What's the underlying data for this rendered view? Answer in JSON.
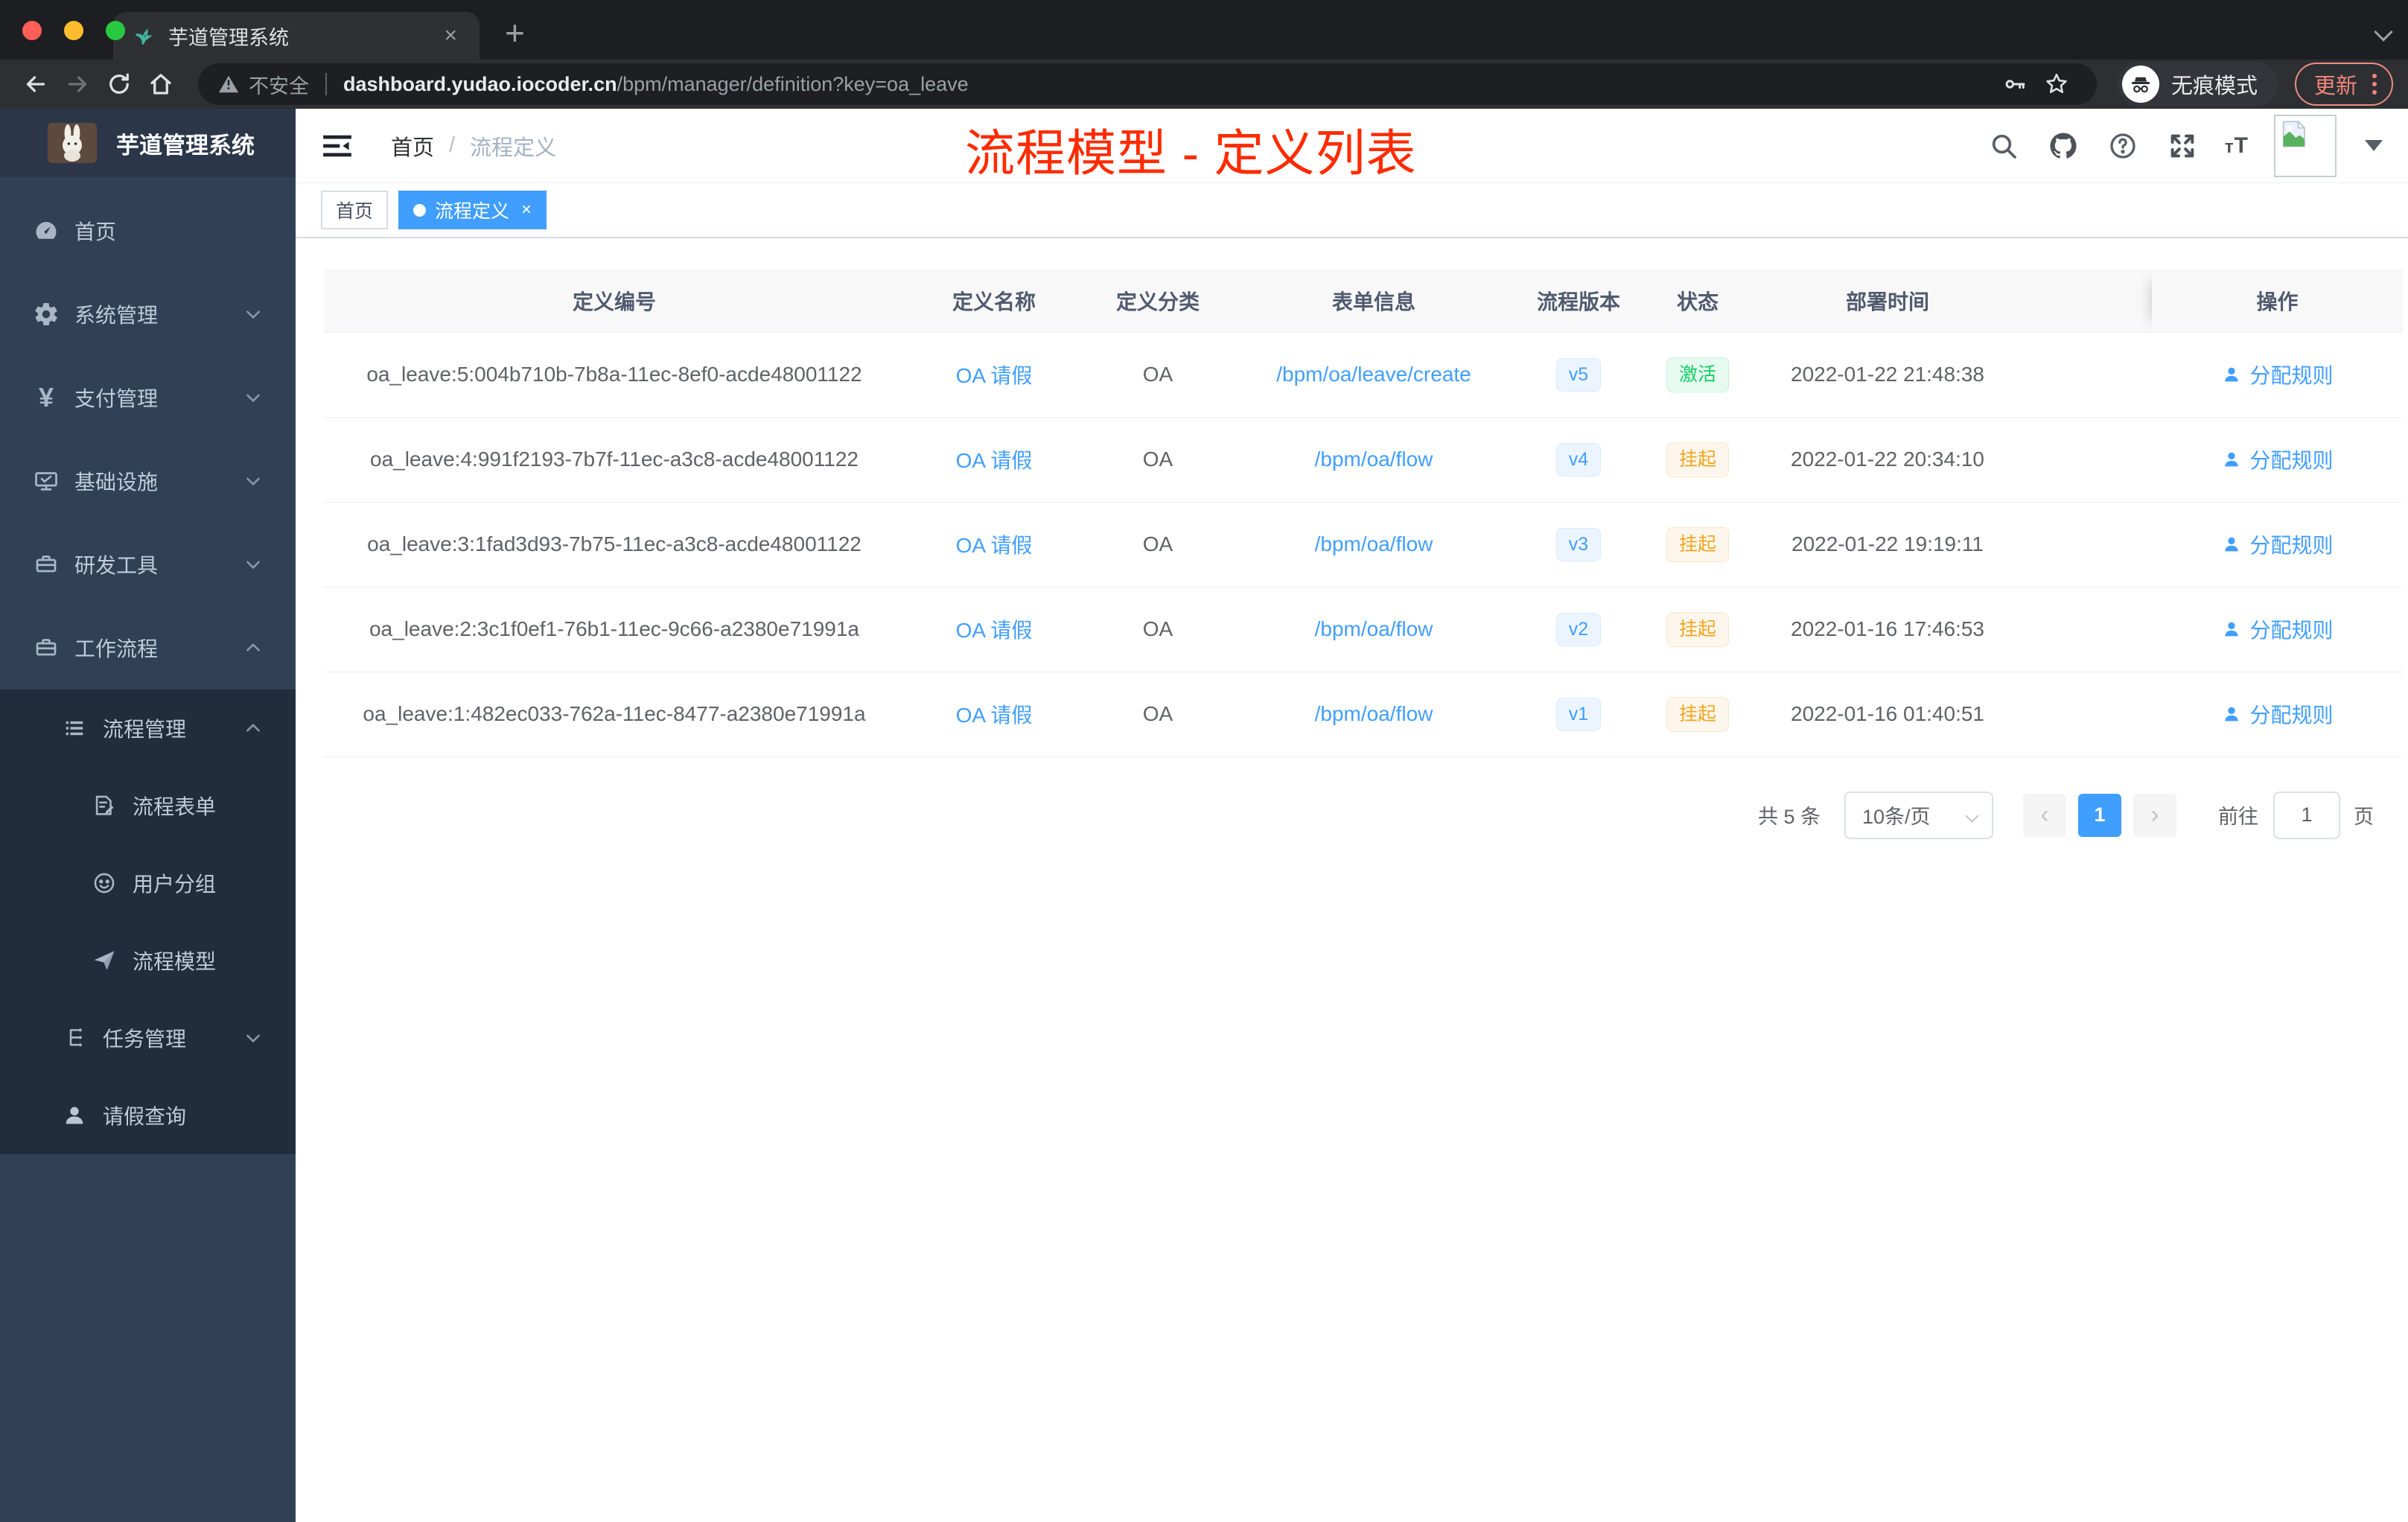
{
  "browser": {
    "tab_title": "芋道管理系统",
    "security_label": "不安全",
    "url_host": "dashboard.yudao.iocoder.cn",
    "url_path": "/bpm/manager/definition?key=oa_leave",
    "incognito_label": "无痕模式",
    "update_label": "更新"
  },
  "sidebar": {
    "app_title": "芋道管理系统",
    "items": [
      {
        "label": "首页",
        "icon": "dashboard-icon",
        "level": 1,
        "chevron": "none"
      },
      {
        "label": "系统管理",
        "icon": "gear-icon",
        "level": 1,
        "chevron": "down"
      },
      {
        "label": "支付管理",
        "icon": "yen-icon",
        "level": 1,
        "chevron": "down"
      },
      {
        "label": "基础设施",
        "icon": "monitor-icon",
        "level": 1,
        "chevron": "down"
      },
      {
        "label": "研发工具",
        "icon": "toolbox-icon",
        "level": 1,
        "chevron": "down"
      },
      {
        "label": "工作流程",
        "icon": "toolbox-icon",
        "level": 1,
        "chevron": "up"
      },
      {
        "label": "流程管理",
        "icon": "list-icon",
        "level": 2,
        "chevron": "up"
      },
      {
        "label": "流程表单",
        "icon": "form-icon",
        "level": 3,
        "chevron": "none"
      },
      {
        "label": "用户分组",
        "icon": "face-icon",
        "level": 3,
        "chevron": "none"
      },
      {
        "label": "流程模型",
        "icon": "send-icon",
        "level": 3,
        "chevron": "none"
      },
      {
        "label": "任务管理",
        "icon": "tree-icon",
        "level": 2,
        "chevron": "down"
      },
      {
        "label": "请假查询",
        "icon": "user-icon",
        "level": 2,
        "chevron": "none"
      }
    ]
  },
  "header": {
    "breadcrumb_home": "首页",
    "breadcrumb_current": "流程定义"
  },
  "annotation": "流程模型 - 定义列表",
  "tags": [
    {
      "label": "首页",
      "active": false
    },
    {
      "label": "流程定义",
      "active": true
    }
  ],
  "table": {
    "columns": [
      "定义编号",
      "定义名称",
      "定义分类",
      "表单信息",
      "流程版本",
      "状态",
      "部署时间",
      "操作"
    ],
    "rows": [
      {
        "id": "oa_leave:5:004b710b-7b8a-11ec-8ef0-acde48001122",
        "name": "OA 请假",
        "category": "OA",
        "form": "/bpm/oa/leave/create",
        "version": "v5",
        "status": "激活",
        "status_type": "success",
        "time": "2022-01-22 21:48:38",
        "action": "分配规则"
      },
      {
        "id": "oa_leave:4:991f2193-7b7f-11ec-a3c8-acde48001122",
        "name": "OA 请假",
        "category": "OA",
        "form": "/bpm/oa/flow",
        "version": "v4",
        "status": "挂起",
        "status_type": "warning",
        "time": "2022-01-22 20:34:10",
        "action": "分配规则"
      },
      {
        "id": "oa_leave:3:1fad3d93-7b75-11ec-a3c8-acde48001122",
        "name": "OA 请假",
        "category": "OA",
        "form": "/bpm/oa/flow",
        "version": "v3",
        "status": "挂起",
        "status_type": "warning",
        "time": "2022-01-22 19:19:11",
        "action": "分配规则"
      },
      {
        "id": "oa_leave:2:3c1f0ef1-76b1-11ec-9c66-a2380e71991a",
        "name": "OA 请假",
        "category": "OA",
        "form": "/bpm/oa/flow",
        "version": "v2",
        "status": "挂起",
        "status_type": "warning",
        "time": "2022-01-16 17:46:53",
        "action": "分配规则"
      },
      {
        "id": "oa_leave:1:482ec033-762a-11ec-8477-a2380e71991a",
        "name": "OA 请假",
        "category": "OA",
        "form": "/bpm/oa/flow",
        "version": "v1",
        "status": "挂起",
        "status_type": "warning",
        "time": "2022-01-16 01:40:51",
        "action": "分配规则"
      }
    ]
  },
  "pagination": {
    "total_label": "共 5 条",
    "page_size_label": "10条/页",
    "current_page": "1",
    "goto_label": "前往",
    "goto_value": "1",
    "page_unit": "页"
  },
  "colors": {
    "accent_blue": "#409eff",
    "success_green": "#13ce66",
    "warning_orange": "#efa51e",
    "annotation_red": "#ff2b00",
    "sidebar_bg": "#304156",
    "submenu_bg": "#1f2d3d",
    "active_tag_bg": "#409eff"
  }
}
